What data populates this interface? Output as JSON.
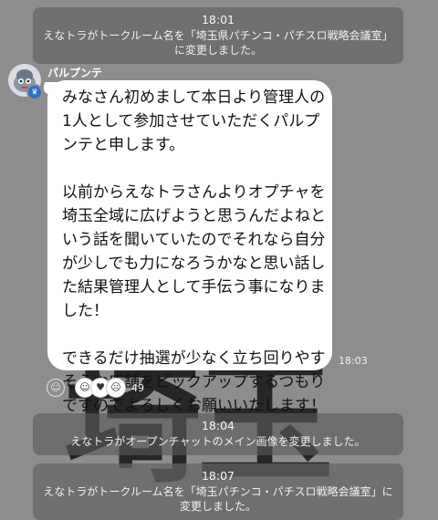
{
  "watermark": "埼玉",
  "system_messages": [
    {
      "time": "18:01",
      "text": "えなトラがトークルーム名を「埼玉県パチンコ・パチスロ戦略会議室」に変更しました。"
    },
    {
      "time": "18:04",
      "text": "えなトラがオープンチャットのメイン画像を変更しました。"
    },
    {
      "time": "18:07",
      "text": "えなトラがトークルーム名を「埼玉パチンコ・パチスロ戦略会議室」に変更しました。"
    }
  ],
  "message": {
    "sender": "パルプンテ",
    "time": "18:03",
    "paragraphs": [
      "みなさん初めまして本日より管理人の\n1人として参加させていただくパルプ\nンテと申します。",
      "以前からえなトラさんよりオプチャを\n埼玉全域に広げようと思うんだよねと\nいう話を聞いていたのでそれなら自分\nが少しでも力になろうかなと思い話し\nた結果管理人として手伝う事になりま\nした！",
      "できるだけ抽選が少なく立ち回りやす\nそうな店舗をピックアップするつもり\nですのでよろしくお願いいたします！"
    ],
    "reactions": {
      "emojis": [
        "smile-face-icon",
        "heart-face-icon",
        "cry-face-icon"
      ],
      "count": "49"
    }
  },
  "colors": {
    "background": "#8d8d8d",
    "bubble": "#ffffff",
    "system_bg": "#646464"
  }
}
